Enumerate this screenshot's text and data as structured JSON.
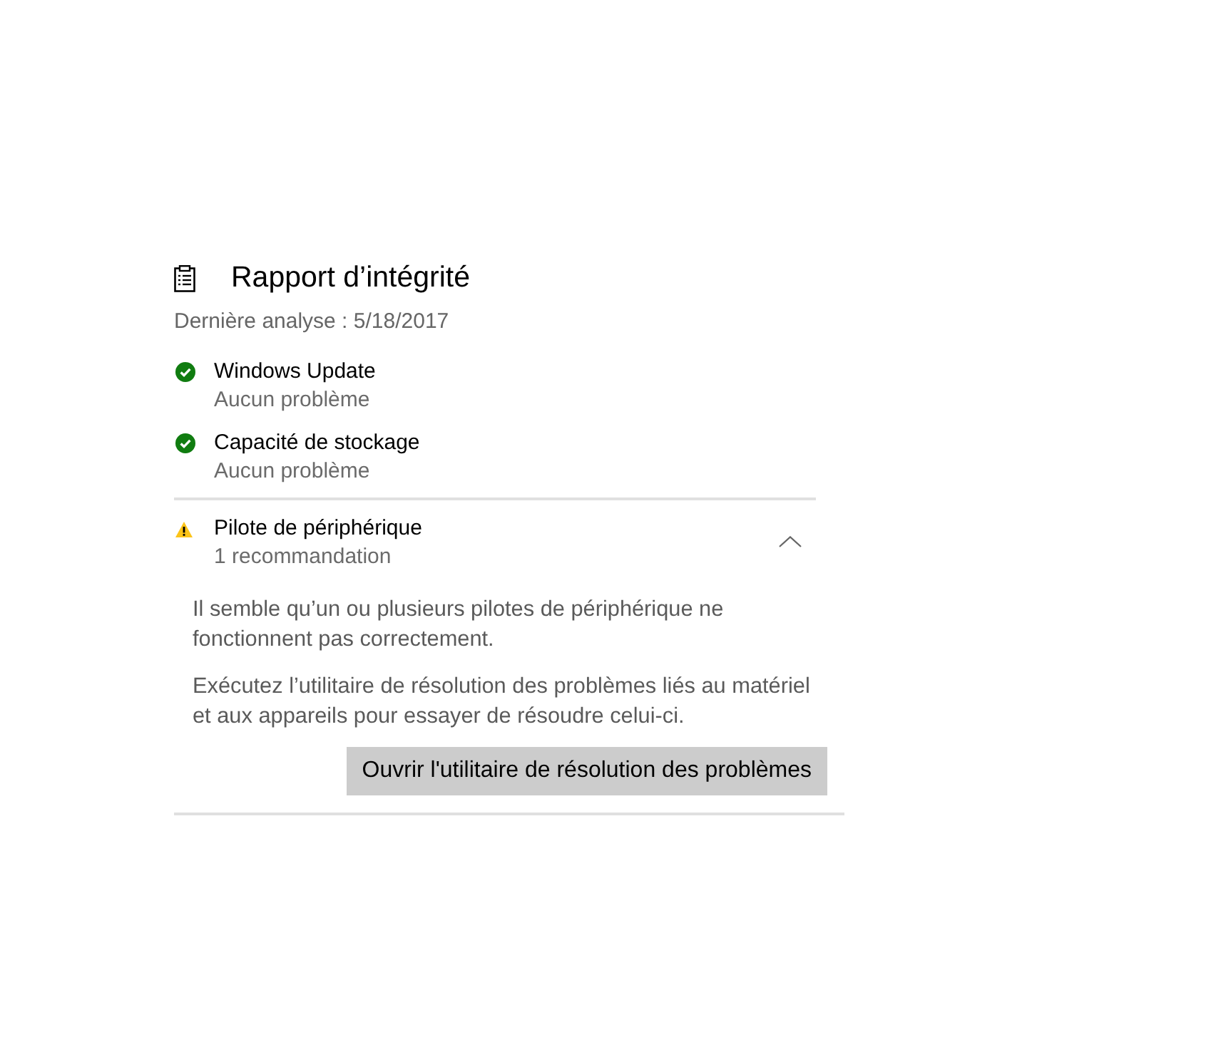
{
  "report": {
    "title": "Rapport d’intégrité",
    "last_scan": "Dernière analyse : 5/18/2017"
  },
  "checks": [
    {
      "kind": "ok",
      "title": "Windows Update",
      "detail": "Aucun problème"
    },
    {
      "kind": "ok",
      "title": "Capacité de stockage",
      "detail": "Aucun problème"
    }
  ],
  "issue": {
    "kind": "warning",
    "title": "Pilote de périphérique",
    "detail": "1 recommandation",
    "expanded": true,
    "paragraphs": [
      "Il semble qu’un ou plusieurs pilotes de périphérique ne fonctionnent pas correctement.",
      "Exécutez l’utilitaire de résolution des problèmes liés au matériel et aux appareils pour essayer de résoudre celui-ci."
    ],
    "button": "Ouvrir l'utilitaire de résolution des problèmes"
  }
}
